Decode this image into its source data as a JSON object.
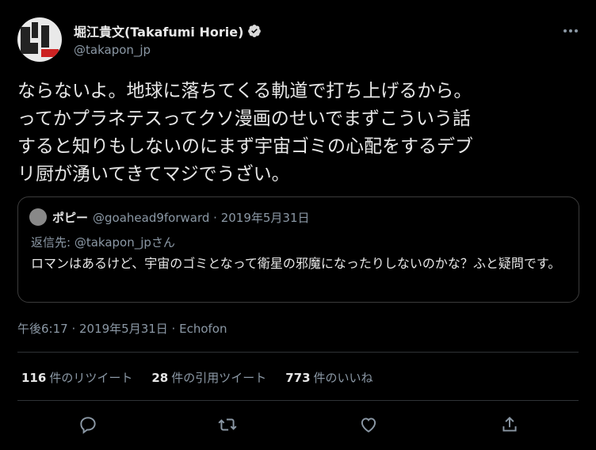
{
  "author": {
    "name": "堀江貴文(Takafumi Horie)",
    "handle": "@takapon_jp"
  },
  "tweet": {
    "text": "ならないよ。地球に落ちてくる軌道で打ち上げるから。\nってかプラネテスってクソ漫画のせいでまずこういう話\nすると知りもしないのにまず宇宙ゴミの心配をするデブ\nリ厨が湧いてきてマジでうざい。"
  },
  "quote": {
    "name": "ポピー",
    "meta": "@goahead9forward · 2019年5月31日",
    "reply_prefix": "返信先: ",
    "reply_handle": "@takapon_jp",
    "reply_suffix": "さん",
    "text": "ロマンはあるけど、宇宙のゴミとなって衛星の邪魔になったりしないのかな？ふと疑問です。"
  },
  "meta": {
    "time": "午後6:17 · 2019年5月31日 · Echofon"
  },
  "stats": {
    "retweets_count": "116",
    "retweets_label": "件のリツイート",
    "quotes_count": "28",
    "quotes_label": "件の引用ツイート",
    "likes_count": "773",
    "likes_label": "件のいいね"
  },
  "colors": {
    "background": "#000000",
    "secondary_text": "#8b98a5",
    "verified": "#d9d9d9"
  },
  "icons": {
    "more": "more-icon",
    "verified": "verified-badge-icon",
    "reply": "reply-icon",
    "retweet": "retweet-icon",
    "like": "like-icon",
    "share": "share-icon"
  }
}
